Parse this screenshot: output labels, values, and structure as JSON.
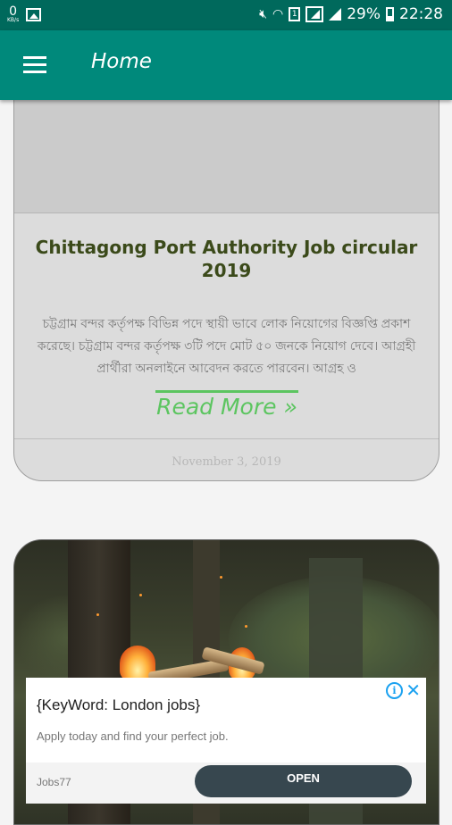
{
  "status_bar": {
    "net_speed_value": "0",
    "net_speed_unit": "KB/s",
    "sim_slot": "1",
    "battery_percent": "29%",
    "time": "22:28"
  },
  "app_bar": {
    "title": "Home",
    "background_color": "#00897b"
  },
  "posts": [
    {
      "title": "Chittagong Port Authority Job circular 2019",
      "excerpt": "চট্টগ্রাম বন্দর কর্তৃপক্ষ বিভিন্ন পদে স্থায়ী ভাবে লোক নিয়োগের বিজ্ঞপ্তি প্রকাশ করেছে। চট্টগ্রাম বন্দর কর্তৃপক্ষ ৩টি পদে মোট ৫০ জনকে নিয়োগ দেবে। আগ্রহী প্রার্থীরা অনলাইনে আবেদন করতে পারবেন। আগ্রহ ও",
      "read_more": "Read More »",
      "date": "November 3, 2019"
    }
  ],
  "ad": {
    "title": "{KeyWord: London jobs}",
    "body": "Apply today and find your perfect job.",
    "advertiser": "Jobs77",
    "cta": "OPEN",
    "info_glyph": "i",
    "close_glyph": "✕"
  },
  "colors": {
    "status_bar": "#00695c",
    "read_more": "#5cc560",
    "title_text": "#3b4a1a",
    "ad_button": "#37474f"
  }
}
